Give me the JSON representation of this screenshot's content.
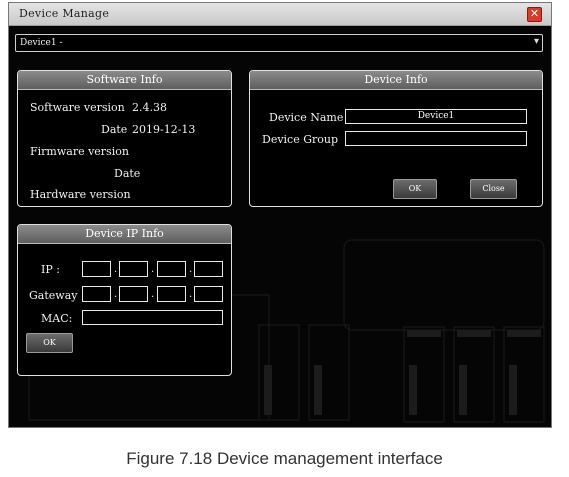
{
  "window": {
    "title": "Device Manage",
    "close_glyph": "✕"
  },
  "device_select": {
    "value": "Device1 -",
    "arrow": "▾"
  },
  "software_info": {
    "title": "Software Info",
    "software_version_label": "Software version",
    "software_version_value": "2.4.38",
    "sw_date_label": "Date",
    "sw_date_value": "2019-12-13",
    "firmware_version_label": "Firmware version",
    "fw_date_label": "Date",
    "hardware_version_label": "Hardware version"
  },
  "device_info": {
    "title": "Device Info",
    "name_label": "Device Name",
    "name_value": "Device1",
    "group_label": "Device Group",
    "group_value": "",
    "ok_label": "OK",
    "close_label": "Close"
  },
  "ip_info": {
    "title": "Device IP Info",
    "ip_label": "IP :",
    "gateway_label": "Gateway",
    "mac_label": "MAC:",
    "dot": ".",
    "ok_label": "OK"
  },
  "caption": "Figure 7.18 Device management interface",
  "colors": {
    "window_bg": "#050505",
    "close_red": "#d93a2b",
    "panel_border": "#e0e0e0"
  }
}
